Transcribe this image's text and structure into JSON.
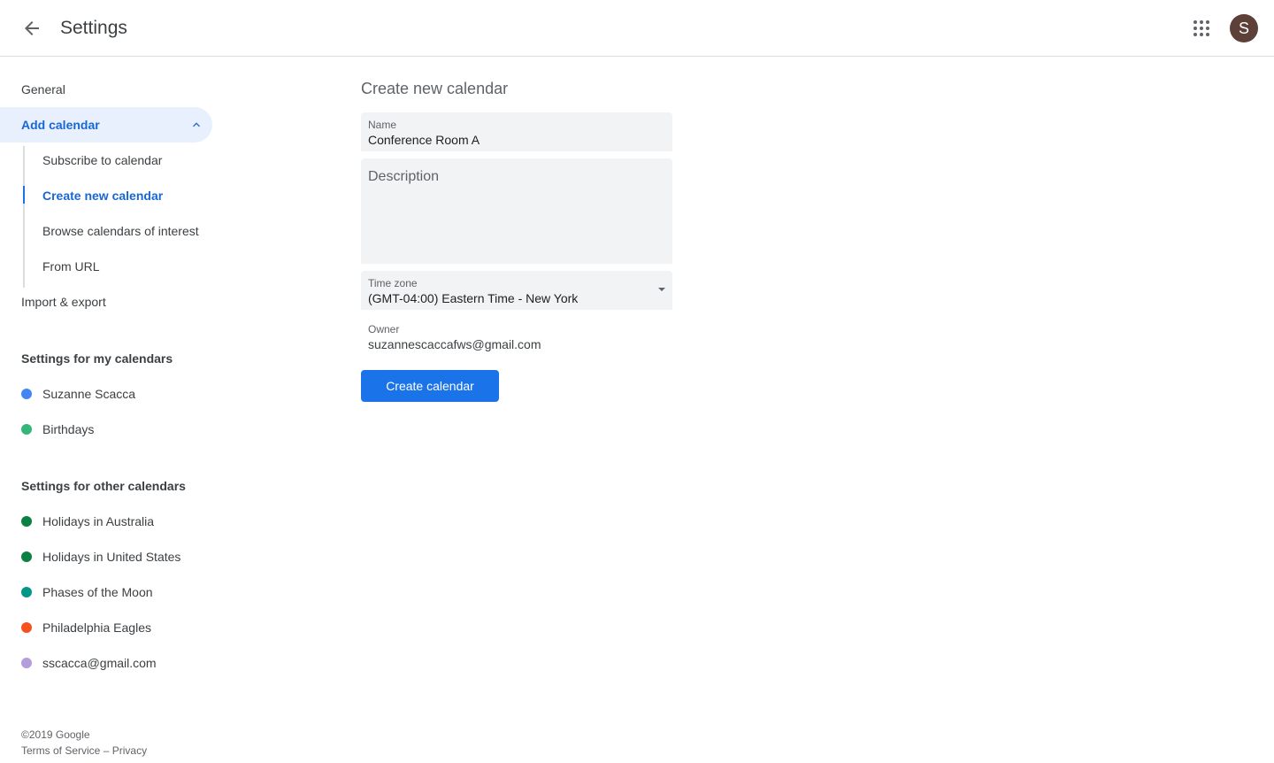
{
  "header": {
    "title": "Settings",
    "avatar_initial": "S"
  },
  "sidebar": {
    "general": "General",
    "add_calendar": "Add calendar",
    "sub_items": [
      "Subscribe to calendar",
      "Create new calendar",
      "Browse calendars of interest",
      "From URL"
    ],
    "import_export": "Import & export",
    "my_calendars_heading": "Settings for my calendars",
    "my_calendars": [
      {
        "name": "Suzanne Scacca",
        "color": "#4285f4"
      },
      {
        "name": "Birthdays",
        "color": "#33b679"
      }
    ],
    "other_calendars_heading": "Settings for other calendars",
    "other_calendars": [
      {
        "name": "Holidays in Australia",
        "color": "#0b8043"
      },
      {
        "name": "Holidays in United States",
        "color": "#0b8043"
      },
      {
        "name": "Phases of the Moon",
        "color": "#009688"
      },
      {
        "name": "Philadelphia Eagles",
        "color": "#f4511e"
      },
      {
        "name": "sscacca@gmail.com",
        "color": "#b39ddb"
      }
    ]
  },
  "footer": {
    "copyright": "©2019 Google",
    "terms": "Terms of Service",
    "separator": "–",
    "privacy": "Privacy"
  },
  "form": {
    "title": "Create new calendar",
    "name_label": "Name",
    "name_value": "Conference Room A",
    "description_placeholder": "Description",
    "timezone_label": "Time zone",
    "timezone_value": "(GMT-04:00) Eastern Time - New York",
    "owner_label": "Owner",
    "owner_value": "suzannescaccafws@gmail.com",
    "create_button": "Create calendar"
  },
  "colors": {
    "accent": "#1a73e8",
    "active_bg": "#e8f0fe",
    "active_text": "#1967d2",
    "avatar_bg": "#5d4037"
  }
}
